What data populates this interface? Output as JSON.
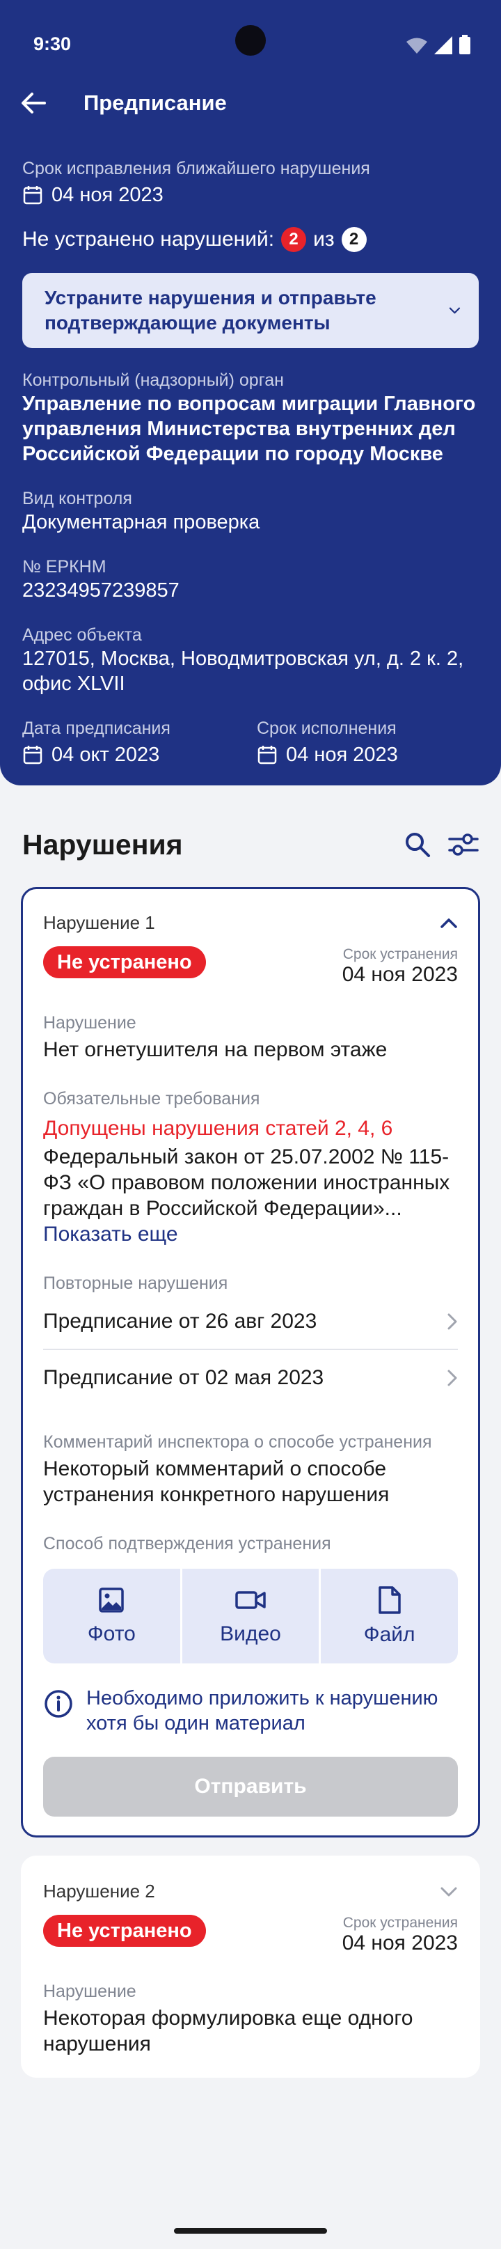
{
  "status_bar": {
    "time": "9:30"
  },
  "app_bar": {
    "title": "Предписание"
  },
  "summary": {
    "nearest_deadline_label": "Срок исправления ближайшего нарушения",
    "nearest_deadline": "04 ноя 2023",
    "unresolved_text": "Не устранено нарушений:",
    "unresolved_count": "2",
    "of_text": "из",
    "total_count": "2",
    "notice": "Устраните нарушения и отправьте подтверждающие документы",
    "authority_label": "Контрольный (надзорный) орган",
    "authority": "Управление по вопросам миграции Главного управления Министерства внутренних дел Российской Федерации по городу Москве",
    "control_type_label": "Вид контроля",
    "control_type": "Документарная проверка",
    "erknm_label": "№ ЕРКНМ",
    "erknm": "23234957239857",
    "address_label": "Адрес объекта",
    "address": "127015, Москва, Новодмитровская ул, д. 2 к. 2, офис XLVII",
    "issue_date_label": "Дата предписания",
    "issue_date": "04 окт 2023",
    "due_date_label": "Срок исполнения",
    "due_date": "04 ноя 2023"
  },
  "violations": {
    "title": "Нарушения",
    "items": [
      {
        "name": "Нарушение 1",
        "status": "Не устранено",
        "deadline_label": "Срок устранения",
        "deadline": "04 ноя 2023",
        "violation_label": "Нарушение",
        "violation": "Нет огнетушителя на первом этаже",
        "requirements_label": "Обязательные требования",
        "requirements_highlight": "Допущены нарушения статей 2, 4, 6",
        "requirements_text": "Федеральный закон от 25.07.2002 № 115-ФЗ «О правовом положении иностранных граждан в Российской Федерации»...",
        "show_more": "Показать еще",
        "repeat_label": "Повторные нарушения",
        "repeats": [
          "Предписание от 26 авг 2023",
          "Предписание от 02 мая 2023"
        ],
        "comment_label": "Комментарий инспектора о способе устранения",
        "comment": "Некоторый комментарий о способе устранения конкретного нарушения",
        "confirm_label": "Способ подтверждения устранения",
        "media": [
          "Фото",
          "Видео",
          "Файл"
        ],
        "info": "Необходимо приложить к нарушению хотя бы один материал",
        "send": "Отправить"
      },
      {
        "name": "Нарушение 2",
        "status": "Не устранено",
        "deadline_label": "Срок устранения",
        "deadline": "04 ноя 2023",
        "violation_label": "Нарушение",
        "violation": "Некоторая формулировка еще одного нарушения"
      }
    ]
  },
  "colors": {
    "primary": "#1f3284",
    "danger": "#e8232a",
    "light": "#e4e8f8"
  }
}
